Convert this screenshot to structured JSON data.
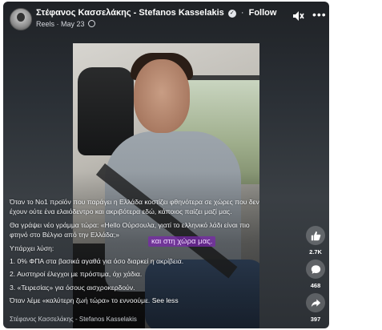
{
  "header": {
    "author": "Στέφανος Κασσελάκης - Stefanos Kasselakis",
    "follow": "Follow",
    "section": "Reels",
    "date": "May 23"
  },
  "caption": {
    "para1": "Όταν το Νο1 προϊόν που παράγει η Ελλάδα κοστίζει φθηνότερα σε χώρες που δεν έχουν ούτε ένα ελαιόδεντρο και ακριβότερα εδώ, κάποιος παίζει μαζί μας.",
    "para2_start": "Θα γράψει νέο γράμμα τώρα: «Hello Ούρσουλα, γιατί το ελληνικό λάδι είναι πιο φτηνό στο Βέλγιο από την Ελλάδα;»",
    "solution_heading": "Υπάρχει λύση:",
    "item1": "1. 0% ΦΠΑ στα βασικά αγαθά για όσο διαρκεί η ακρίβεια.",
    "item2": "2. Αυστηροί έλεγχοι με πρόστιμα, όχι χάδια.",
    "item3": "3. «Τειρεσίας» για όσους αισχροκερδούν.",
    "closing": "Όταν λέμε «καλύτερη ζωή τώρα» το εννοούμε.",
    "see_less": "See less"
  },
  "subtitle": "και στη χώρα μας.",
  "footer_name": "Στέφανος Κασσελάκης - Stefanos Kasselakis",
  "actions": {
    "likes": "2.7K",
    "comments": "468",
    "shares": "397"
  },
  "icons": [
    "mute-icon",
    "more-icon",
    "like-icon",
    "comment-icon",
    "share-icon",
    "globe-icon",
    "verified-icon"
  ]
}
